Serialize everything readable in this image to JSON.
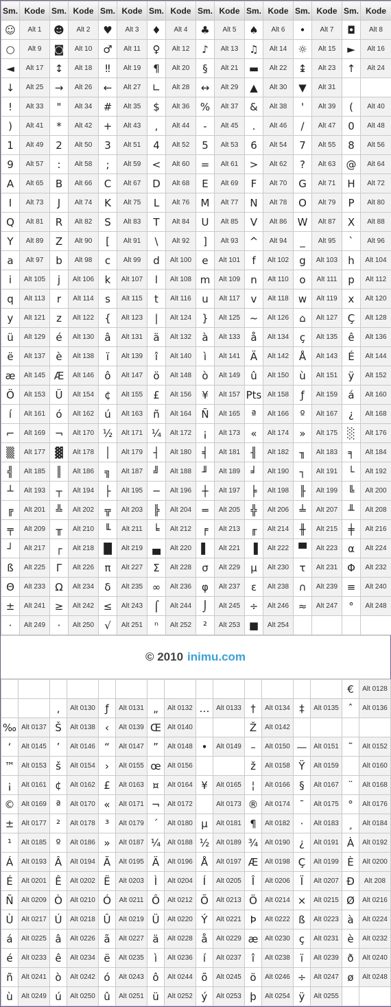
{
  "header": {
    "sym": "Sm.",
    "code": "Kode"
  },
  "top_rows": [
    [
      [
        "☺",
        "Alt 1"
      ],
      [
        "☻",
        "Alt 2"
      ],
      [
        "♥",
        "Alt 3"
      ],
      [
        "♦",
        "Alt 4"
      ],
      [
        "♣",
        "Alt 5"
      ],
      [
        "♠",
        "Alt 6"
      ],
      [
        "•",
        "Alt 7"
      ],
      [
        "◘",
        "Alt 8"
      ]
    ],
    [
      [
        "○",
        "Alt 9"
      ],
      [
        "◙",
        "Alt 10"
      ],
      [
        "♂",
        "Alt 11"
      ],
      [
        "♀",
        "Alt 12"
      ],
      [
        "♪",
        "Alt 13"
      ],
      [
        "♫",
        "Alt 14"
      ],
      [
        "☼",
        "Alt 15"
      ],
      [
        "►",
        "Alt 16"
      ]
    ],
    [
      [
        "◄",
        "Alt 17"
      ],
      [
        "↕",
        "Alt 18"
      ],
      [
        "‼",
        "Alt 19"
      ],
      [
        "¶",
        "Alt 20"
      ],
      [
        "§",
        "Alt 21"
      ],
      [
        "▬",
        "Alt 22"
      ],
      [
        "↨",
        "Alt 23"
      ],
      [
        "↑",
        "Alt 24"
      ]
    ],
    [
      [
        "↓",
        "Alt 25"
      ],
      [
        "→",
        "Alt 26"
      ],
      [
        "←",
        "Alt 27"
      ],
      [
        "∟",
        "Alt 28"
      ],
      [
        "↔",
        "Alt 29"
      ],
      [
        "▲",
        "Alt 30"
      ],
      [
        "▼",
        "Alt 31"
      ],
      [
        "",
        ""
      ]
    ],
    [
      [
        "!",
        "Alt 33"
      ],
      [
        "\"",
        "Alt 34"
      ],
      [
        "#",
        "Alt 35"
      ],
      [
        "$",
        "Alt 36"
      ],
      [
        "%",
        "Alt 37"
      ],
      [
        "&",
        "Alt 38"
      ],
      [
        "'",
        "Alt 39"
      ],
      [
        "(",
        "Alt 40"
      ]
    ],
    [
      [
        ")",
        "Alt 41"
      ],
      [
        "*",
        "Alt 42"
      ],
      [
        "+",
        "Alt 43"
      ],
      [
        ",",
        "Alt 44"
      ],
      [
        "-",
        "Alt 45"
      ],
      [
        ".",
        "Alt 46"
      ],
      [
        "/",
        "Alt 47"
      ],
      [
        "0",
        "Alt 48"
      ]
    ],
    [
      [
        "1",
        "Alt 49"
      ],
      [
        "2",
        "Alt 50"
      ],
      [
        "3",
        "Alt 51"
      ],
      [
        "4",
        "Alt 52"
      ],
      [
        "5",
        "Alt 53"
      ],
      [
        "6",
        "Alt 54"
      ],
      [
        "7",
        "Alt 55"
      ],
      [
        "8",
        "Alt 56"
      ]
    ],
    [
      [
        "9",
        "Alt 57"
      ],
      [
        ":",
        "Alt 58"
      ],
      [
        ";",
        "Alt 59"
      ],
      [
        "<",
        "Alt 60"
      ],
      [
        "=",
        "Alt 61"
      ],
      [
        ">",
        "Alt 62"
      ],
      [
        "?",
        "Alt 63"
      ],
      [
        "@",
        "Alt 64"
      ]
    ],
    [
      [
        "A",
        "Alt 65"
      ],
      [
        "B",
        "Alt 66"
      ],
      [
        "C",
        "Alt 67"
      ],
      [
        "D",
        "Alt 68"
      ],
      [
        "E",
        "Alt 69"
      ],
      [
        "F",
        "Alt 70"
      ],
      [
        "G",
        "Alt 71"
      ],
      [
        "H",
        "Alt 72"
      ]
    ],
    [
      [
        "I",
        "Alt 73"
      ],
      [
        "J",
        "Alt 74"
      ],
      [
        "K",
        "Alt 75"
      ],
      [
        "L",
        "Alt 76"
      ],
      [
        "M",
        "Alt 77"
      ],
      [
        "N",
        "Alt 78"
      ],
      [
        "O",
        "Alt 79"
      ],
      [
        "P",
        "Alt 80"
      ]
    ],
    [
      [
        "Q",
        "Alt 81"
      ],
      [
        "R",
        "Alt 82"
      ],
      [
        "S",
        "Alt 83"
      ],
      [
        "T",
        "Alt 84"
      ],
      [
        "U",
        "Alt 85"
      ],
      [
        "V",
        "Alt 86"
      ],
      [
        "W",
        "Alt 87"
      ],
      [
        "X",
        "Alt 88"
      ]
    ],
    [
      [
        "Y",
        "Alt 89"
      ],
      [
        "Z",
        "Alt 90"
      ],
      [
        "[",
        "Alt 91"
      ],
      [
        "\\",
        "Alt 92"
      ],
      [
        "]",
        "Alt 93"
      ],
      [
        "^",
        "Alt 94"
      ],
      [
        "_",
        "Alt 95"
      ],
      [
        "`",
        "Alt 96"
      ]
    ],
    [
      [
        "a",
        "Alt 97"
      ],
      [
        "b",
        "Alt 98"
      ],
      [
        "c",
        "Alt 99"
      ],
      [
        "d",
        "Alt 100"
      ],
      [
        "e",
        "Alt 101"
      ],
      [
        "f",
        "Alt 102"
      ],
      [
        "g",
        "Alt 103"
      ],
      [
        "h",
        "Alt 104"
      ]
    ],
    [
      [
        "i",
        "Alt 105"
      ],
      [
        "j",
        "Alt 106"
      ],
      [
        "k",
        "Alt 107"
      ],
      [
        "l",
        "Alt 108"
      ],
      [
        "m",
        "Alt 109"
      ],
      [
        "n",
        "Alt 110"
      ],
      [
        "o",
        "Alt 111"
      ],
      [
        "p",
        "Alt 112"
      ]
    ],
    [
      [
        "q",
        "Alt 113"
      ],
      [
        "r",
        "Alt 114"
      ],
      [
        "s",
        "Alt 115"
      ],
      [
        "t",
        "Alt 116"
      ],
      [
        "u",
        "Alt 117"
      ],
      [
        "v",
        "Alt 118"
      ],
      [
        "w",
        "Alt 119"
      ],
      [
        "x",
        "Alt 120"
      ]
    ],
    [
      [
        "y",
        "Alt 121"
      ],
      [
        "z",
        "Alt 122"
      ],
      [
        "{",
        "Alt 123"
      ],
      [
        "|",
        "Alt 124"
      ],
      [
        "}",
        "Alt 125"
      ],
      [
        "~",
        "Alt 126"
      ],
      [
        "⌂",
        "Alt 127"
      ],
      [
        "Ç",
        "Alt 128"
      ]
    ],
    [
      [
        "ü",
        "Alt 129"
      ],
      [
        "é",
        "Alt 130"
      ],
      [
        "â",
        "Alt 131"
      ],
      [
        "ä",
        "Alt 132"
      ],
      [
        "à",
        "Alt 133"
      ],
      [
        "å",
        "Alt 134"
      ],
      [
        "ç",
        "Alt 135"
      ],
      [
        "ê",
        "Alt 136"
      ]
    ],
    [
      [
        "ë",
        "Alt 137"
      ],
      [
        "è",
        "Alt 138"
      ],
      [
        "ï",
        "Alt 139"
      ],
      [
        "î",
        "Alt 140"
      ],
      [
        "ì",
        "Alt 141"
      ],
      [
        "Ä",
        "Alt 142"
      ],
      [
        "Å",
        "Alt 143"
      ],
      [
        "É",
        "Alt 144"
      ]
    ],
    [
      [
        "æ",
        "Alt 145"
      ],
      [
        "Æ",
        "Alt 146"
      ],
      [
        "ô",
        "Alt 147"
      ],
      [
        "ö",
        "Alt 148"
      ],
      [
        "ò",
        "Alt 149"
      ],
      [
        "û",
        "Alt 150"
      ],
      [
        "ù",
        "Alt 151"
      ],
      [
        "ÿ",
        "Alt 152"
      ]
    ],
    [
      [
        "Ö",
        "Alt 153"
      ],
      [
        "Ü",
        "Alt 154"
      ],
      [
        "¢",
        "Alt 155"
      ],
      [
        "£",
        "Alt 156"
      ],
      [
        "¥",
        "Alt 157"
      ],
      [
        "Pts",
        "Alt 158"
      ],
      [
        "ƒ",
        "Alt 159"
      ],
      [
        "á",
        "Alt 160"
      ]
    ],
    [
      [
        "í",
        "Alt 161"
      ],
      [
        "ó",
        "Alt 162"
      ],
      [
        "ú",
        "Alt 163"
      ],
      [
        "ñ",
        "Alt 164"
      ],
      [
        "Ñ",
        "Alt 165"
      ],
      [
        "ª",
        "Alt 166"
      ],
      [
        "º",
        "Alt 167"
      ],
      [
        "¿",
        "Alt 168"
      ]
    ],
    [
      [
        "⌐",
        "Alt 169"
      ],
      [
        "¬",
        "Alt 170"
      ],
      [
        "½",
        "Alt 171"
      ],
      [
        "¼",
        "Alt 172"
      ],
      [
        "¡",
        "Alt 173"
      ],
      [
        "«",
        "Alt 174"
      ],
      [
        "»",
        "Alt 175"
      ],
      [
        "░",
        "Alt 176"
      ]
    ],
    [
      [
        "▒",
        "Alt 177"
      ],
      [
        "▓",
        "Alt 178"
      ],
      [
        "│",
        "Alt 179"
      ],
      [
        "┤",
        "Alt 180"
      ],
      [
        "╡",
        "Alt 181"
      ],
      [
        "╢",
        "Alt 182"
      ],
      [
        "╖",
        "Alt 183"
      ],
      [
        "╕",
        "Alt 184"
      ]
    ],
    [
      [
        "╣",
        "Alt 185"
      ],
      [
        "║",
        "Alt 186"
      ],
      [
        "╗",
        "Alt 187"
      ],
      [
        "╝",
        "Alt 188"
      ],
      [
        "╜",
        "Alt 189"
      ],
      [
        "╛",
        "Alt 190"
      ],
      [
        "┐",
        "Alt 191"
      ],
      [
        "└",
        "Alt 192"
      ]
    ],
    [
      [
        "┴",
        "Alt 193"
      ],
      [
        "┬",
        "Alt 194"
      ],
      [
        "├",
        "Alt 195"
      ],
      [
        "─",
        "Alt 196"
      ],
      [
        "┼",
        "Alt 197"
      ],
      [
        "╞",
        "Alt 198"
      ],
      [
        "╟",
        "Alt 199"
      ],
      [
        "╚",
        "Alt 200"
      ]
    ],
    [
      [
        "╔",
        "Alt 201"
      ],
      [
        "╩",
        "Alt 202"
      ],
      [
        "╦",
        "Alt 203"
      ],
      [
        "╠",
        "Alt 204"
      ],
      [
        "═",
        "Alt 205"
      ],
      [
        "╬",
        "Alt 206"
      ],
      [
        "╧",
        "Alt 207"
      ],
      [
        "╨",
        "Alt 208"
      ]
    ],
    [
      [
        "╤",
        "Alt 209"
      ],
      [
        "╥",
        "Alt 210"
      ],
      [
        "╙",
        "Alt 211"
      ],
      [
        "╘",
        "Alt 212"
      ],
      [
        "╒",
        "Alt 213"
      ],
      [
        "╓",
        "Alt 214"
      ],
      [
        "╫",
        "Alt 215"
      ],
      [
        "╪",
        "Alt 216"
      ]
    ],
    [
      [
        "┘",
        "Alt 217"
      ],
      [
        "┌",
        "Alt 218"
      ],
      [
        "█",
        "Alt 219"
      ],
      [
        "▄",
        "Alt 220"
      ],
      [
        "▌",
        "Alt 221"
      ],
      [
        "▐",
        "Alt 222"
      ],
      [
        "▀",
        "Alt 223"
      ],
      [
        "α",
        "Alt 224"
      ]
    ],
    [
      [
        "ß",
        "Alt 225"
      ],
      [
        "Γ",
        "Alt 226"
      ],
      [
        "π",
        "Alt 227"
      ],
      [
        "Σ",
        "Alt 228"
      ],
      [
        "σ",
        "Alt 229"
      ],
      [
        "µ",
        "Alt 230"
      ],
      [
        "τ",
        "Alt 231"
      ],
      [
        "Φ",
        "Alt 232"
      ]
    ],
    [
      [
        "Θ",
        "Alt 233"
      ],
      [
        "Ω",
        "Alt 234"
      ],
      [
        "δ",
        "Alt 235"
      ],
      [
        "∞",
        "Alt 236"
      ],
      [
        "φ",
        "Alt 237"
      ],
      [
        "ε",
        "Alt 238"
      ],
      [
        "∩",
        "Alt 239"
      ],
      [
        "≡",
        "Alt 240"
      ]
    ],
    [
      [
        "±",
        "Alt 241"
      ],
      [
        "≥",
        "Alt 242"
      ],
      [
        "≤",
        "Alt 243"
      ],
      [
        "⌠",
        "Alt 244"
      ],
      [
        "⌡",
        "Alt 245"
      ],
      [
        "÷",
        "Alt 246"
      ],
      [
        "≈",
        "Alt 247"
      ],
      [
        "°",
        "Alt 248"
      ]
    ],
    [
      [
        "·",
        "Alt 249"
      ],
      [
        "·",
        "Alt 250"
      ],
      [
        "√",
        "Alt 251"
      ],
      [
        "ⁿ",
        "Alt 252"
      ],
      [
        "²",
        "Alt 253"
      ],
      [
        "■",
        "Alt 254"
      ],
      [
        "",
        ""
      ],
      [
        "",
        ""
      ]
    ]
  ],
  "footer": {
    "copyright": "© 2010",
    "site": "inimu.com"
  },
  "bottom_rows": [
    [
      [
        "",
        ""
      ],
      [
        "",
        ""
      ],
      [
        "",
        ""
      ],
      [
        "",
        ""
      ],
      [
        "",
        ""
      ],
      [
        "",
        ""
      ],
      [
        "",
        ""
      ],
      [
        "€",
        "Alt 0128"
      ]
    ],
    [
      [
        "",
        ""
      ],
      [
        "‚",
        "Alt 0130"
      ],
      [
        "ƒ",
        "Alt 0131"
      ],
      [
        "„",
        "Alt 0132"
      ],
      [
        "…",
        "Alt 0133"
      ],
      [
        "†",
        "Alt 0134"
      ],
      [
        "‡",
        "Alt 0135"
      ],
      [
        "ˆ",
        "Alt 0136"
      ]
    ],
    [
      [
        "‰",
        "Alt 0137"
      ],
      [
        "Š",
        "Alt 0138"
      ],
      [
        "‹",
        "Alt 0139"
      ],
      [
        "Œ",
        "Alt 0140"
      ],
      [
        "",
        ""
      ],
      [
        "Ž",
        "Alt 0142"
      ],
      [
        "",
        ""
      ],
      [
        "",
        ""
      ]
    ],
    [
      [
        "‘",
        "Alt 0145"
      ],
      [
        "’",
        "Alt 0146"
      ],
      [
        "“",
        "Alt 0147"
      ],
      [
        "”",
        "Alt 0148"
      ],
      [
        "•",
        "Alt 0149"
      ],
      [
        "–",
        "Alt 0150"
      ],
      [
        "—",
        "Alt 0151"
      ],
      [
        "˜",
        "Alt 0152"
      ]
    ],
    [
      [
        "™",
        "Alt 0153"
      ],
      [
        "š",
        "Alt 0154"
      ],
      [
        "›",
        "Alt 0155"
      ],
      [
        "œ",
        "Alt 0156"
      ],
      [
        "",
        ""
      ],
      [
        "ž",
        "Alt 0158"
      ],
      [
        "Ÿ",
        "Alt 0159"
      ],
      [
        "",
        "Alt 0160"
      ]
    ],
    [
      [
        "¡",
        "Alt 0161"
      ],
      [
        "¢",
        "Alt 0162"
      ],
      [
        "£",
        "Alt 0163"
      ],
      [
        "¤",
        "Alt 0164"
      ],
      [
        "¥",
        "Alt 0165"
      ],
      [
        "¦",
        "Alt 0166"
      ],
      [
        "§",
        "Alt 0167"
      ],
      [
        "¨",
        "Alt 0168"
      ]
    ],
    [
      [
        "©",
        "Alt 0169"
      ],
      [
        "ª",
        "Alt 0170"
      ],
      [
        "«",
        "Alt 0171"
      ],
      [
        "¬",
        "Alt 0172"
      ],
      [
        "",
        "Alt 0173"
      ],
      [
        "®",
        "Alt 0174"
      ],
      [
        "¯",
        "Alt 0175"
      ],
      [
        "°",
        "Alt 0176"
      ]
    ],
    [
      [
        "±",
        "Alt 0177"
      ],
      [
        "²",
        "Alt 0178"
      ],
      [
        "³",
        "Alt 0179"
      ],
      [
        "´",
        "Alt 0180"
      ],
      [
        "µ",
        "Alt 0181"
      ],
      [
        "¶",
        "Alt 0182"
      ],
      [
        "·",
        "Alt 0183"
      ],
      [
        "¸",
        "Alt 0184"
      ]
    ],
    [
      [
        "¹",
        "Alt 0185"
      ],
      [
        "º",
        "Alt 0186"
      ],
      [
        "»",
        "Alt 0187"
      ],
      [
        "¼",
        "Alt 0188"
      ],
      [
        "½",
        "Alt 0189"
      ],
      [
        "¾",
        "Alt 0190"
      ],
      [
        "¿",
        "Alt 0191"
      ],
      [
        "À",
        "Alt 0192"
      ]
    ],
    [
      [
        "Á",
        "Alt 0193"
      ],
      [
        "Â",
        "Alt 0194"
      ],
      [
        "Ã",
        "Alt 0195"
      ],
      [
        "Ä",
        "Alt 0196"
      ],
      [
        "Å",
        "Alt 0197"
      ],
      [
        "Æ",
        "Alt 0198"
      ],
      [
        "Ç",
        "Alt 0199"
      ],
      [
        "È",
        "Alt 0200"
      ]
    ],
    [
      [
        "É",
        "Alt 0201"
      ],
      [
        "Ê",
        "Alt 0202"
      ],
      [
        "Ë",
        "Alt 0203"
      ],
      [
        "Ì",
        "Alt 0204"
      ],
      [
        "Í",
        "Alt 0205"
      ],
      [
        "Î",
        "Alt 0206"
      ],
      [
        "Ï",
        "Alt 0207"
      ],
      [
        "Ð",
        "Alt 208"
      ]
    ],
    [
      [
        "Ñ",
        "Alt 0209"
      ],
      [
        "Ò",
        "Alt 0210"
      ],
      [
        "Ó",
        "Alt 0211"
      ],
      [
        "Ô",
        "Alt 0212"
      ],
      [
        "Õ",
        "Alt 0213"
      ],
      [
        "Ö",
        "Alt 0214"
      ],
      [
        "×",
        "Alt 0215"
      ],
      [
        "Ø",
        "Alt 0216"
      ]
    ],
    [
      [
        "Ù",
        "Alt 0217"
      ],
      [
        "Ú",
        "Alt 0218"
      ],
      [
        "Û",
        "Alt 0219"
      ],
      [
        "Ü",
        "Alt 0220"
      ],
      [
        "Ý",
        "Alt 0221"
      ],
      [
        "Þ",
        "Alt 0222"
      ],
      [
        "ß",
        "Alt 0223"
      ],
      [
        "à",
        "Alt 0224"
      ]
    ],
    [
      [
        "á",
        "Alt 0225"
      ],
      [
        "â",
        "Alt 0226"
      ],
      [
        "ã",
        "Alt 0227"
      ],
      [
        "ä",
        "Alt 0228"
      ],
      [
        "å",
        "Alt 0229"
      ],
      [
        "æ",
        "Alt 0230"
      ],
      [
        "ç",
        "Alt 0231"
      ],
      [
        "è",
        "Alt 0232"
      ]
    ],
    [
      [
        "é",
        "Alt 0233"
      ],
      [
        "ê",
        "Alt 0234"
      ],
      [
        "ë",
        "Alt 0235"
      ],
      [
        "ì",
        "Alt 0236"
      ],
      [
        "í",
        "Alt 0237"
      ],
      [
        "î",
        "Alt 0238"
      ],
      [
        "ï",
        "Alt 0239"
      ],
      [
        "ð",
        "Alt 0240"
      ]
    ],
    [
      [
        "ñ",
        "Alt 0241"
      ],
      [
        "ò",
        "Alt 0242"
      ],
      [
        "ó",
        "Alt 0243"
      ],
      [
        "ô",
        "Alt 0244"
      ],
      [
        "õ",
        "Alt 0245"
      ],
      [
        "ö",
        "Alt 0246"
      ],
      [
        "÷",
        "Alt 0247"
      ],
      [
        "ø",
        "Alt 0248"
      ]
    ],
    [
      [
        "ù",
        "Alt 0249"
      ],
      [
        "ú",
        "Alt 0250"
      ],
      [
        "û",
        "Alt 0251"
      ],
      [
        "ü",
        "Alt 0252"
      ],
      [
        "ý",
        "Alt 0253"
      ],
      [
        "þ",
        "Alt 0254"
      ],
      [
        "ÿ",
        "Alt 0255"
      ],
      [
        "",
        ""
      ]
    ]
  ],
  "colors": {
    "border": "#c9c9c9",
    "code_bg": "#f1f1f1",
    "header_bg": "#d9d9d9",
    "footer_site": "#3aa0d8",
    "frame": "#6b5a86"
  }
}
